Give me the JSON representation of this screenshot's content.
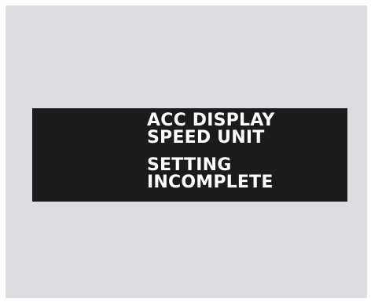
{
  "colors": {
    "background": "#dcdde0",
    "display_bar": "#1b1b1b",
    "text": "#ffffff"
  },
  "display": {
    "title_line1": "ACC DISPLAY",
    "title_line2": "SPEED UNIT",
    "status_line1": "SETTING",
    "status_line2": "INCOMPLETE"
  }
}
